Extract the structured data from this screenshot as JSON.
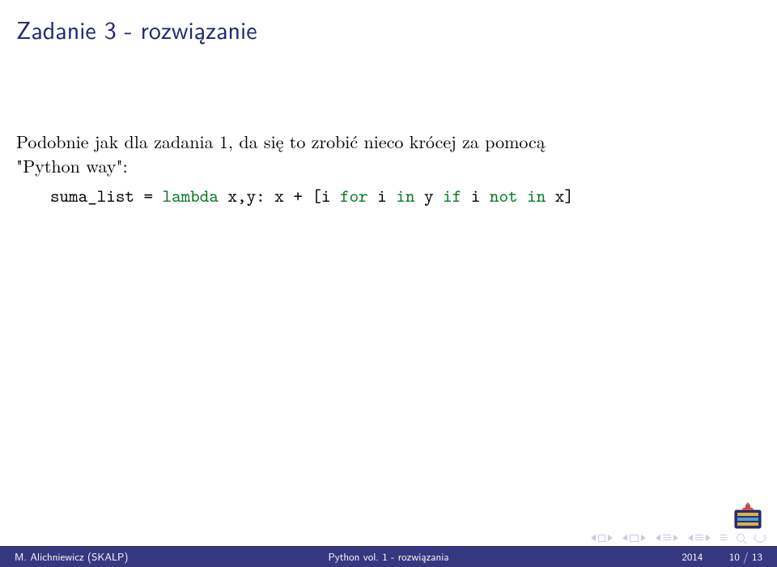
{
  "title": "Zadanie 3 - rozwiązanie",
  "body": {
    "line1": "Podobnie jak dla zadania 1, da się to zrobić nieco krócej za pomocą",
    "line2": "\"Python way\":"
  },
  "code": {
    "p1": "suma_list = ",
    "kw_lambda": "lambda",
    "p2": " x,y: x + [i ",
    "kw_for": "for",
    "p3": " i ",
    "kw_in1": "in",
    "p4": " y ",
    "kw_if": "if",
    "p5": " i ",
    "kw_not": "not",
    "p6": " ",
    "kw_in2": "in",
    "p7": " x]"
  },
  "footer": {
    "author": "M. Alichniewicz (SKALP)",
    "center": "Python vol. 1 - rozwiązania",
    "year": "2014",
    "page": "10 / 13"
  }
}
